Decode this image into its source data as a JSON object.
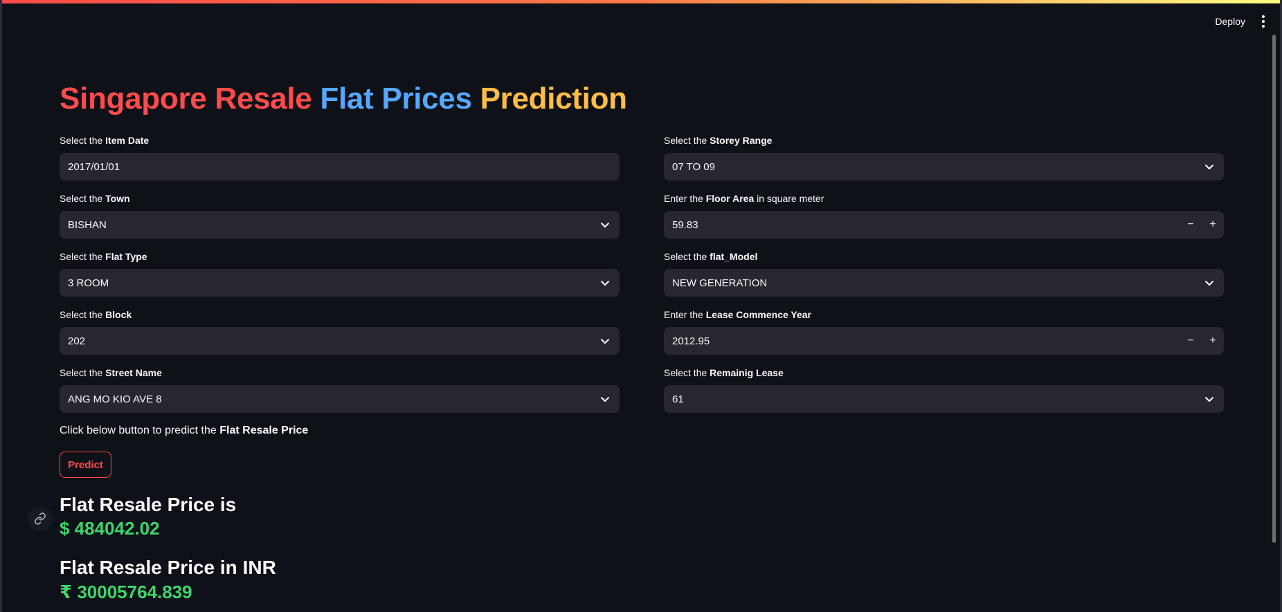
{
  "header": {
    "deploy_label": "Deploy"
  },
  "title": {
    "part1": "Singapore Resale",
    "part2": "Flat Prices",
    "part3": "Prediction"
  },
  "fields": {
    "item_date": {
      "prefix": "Select the",
      "bold": "Item Date",
      "suffix": "",
      "value": "2017/01/01"
    },
    "town": {
      "prefix": "Select the",
      "bold": "Town",
      "suffix": "",
      "value": "BISHAN"
    },
    "flat_type": {
      "prefix": "Select the",
      "bold": "Flat Type",
      "suffix": "",
      "value": "3 ROOM"
    },
    "block": {
      "prefix": "Select the",
      "bold": "Block",
      "suffix": "",
      "value": "202"
    },
    "street_name": {
      "prefix": "Select the",
      "bold": "Street Name",
      "suffix": "",
      "value": "ANG MO KIO AVE 8"
    },
    "storey_range": {
      "prefix": "Select the",
      "bold": "Storey Range",
      "suffix": "",
      "value": "07 TO 09"
    },
    "floor_area": {
      "prefix": "Enter the",
      "bold": "Floor Area",
      "suffix": "in square meter",
      "value": "59.83"
    },
    "flat_model": {
      "prefix": "Select the",
      "bold": "flat_Model",
      "suffix": "",
      "value": "NEW GENERATION"
    },
    "lease_commence": {
      "prefix": "Enter the",
      "bold": "Lease Commence Year",
      "suffix": "",
      "value": "2012.95"
    },
    "remaining_lease": {
      "prefix": "Select the",
      "bold": "Remainig Lease",
      "suffix": "",
      "value": "61"
    }
  },
  "stepper": {
    "minus": "−",
    "plus": "+"
  },
  "hint": {
    "text": "Click below button to predict the",
    "bold": "Flat Resale Price"
  },
  "predict_label": "Predict",
  "results": {
    "usd_heading": "Flat Resale Price is",
    "usd_value": "$ 484042.02",
    "inr_heading": "Flat Resale Price in INR",
    "inr_value": "₹ 30005764.839"
  },
  "colors": {
    "accent_red": "#ff4b4b",
    "title_blue": "#55a7ff",
    "title_orange": "#ffbd45",
    "result_green": "#3dd56d"
  },
  "icons": [
    "menu-icon",
    "chevron-down-icon",
    "link-icon"
  ]
}
